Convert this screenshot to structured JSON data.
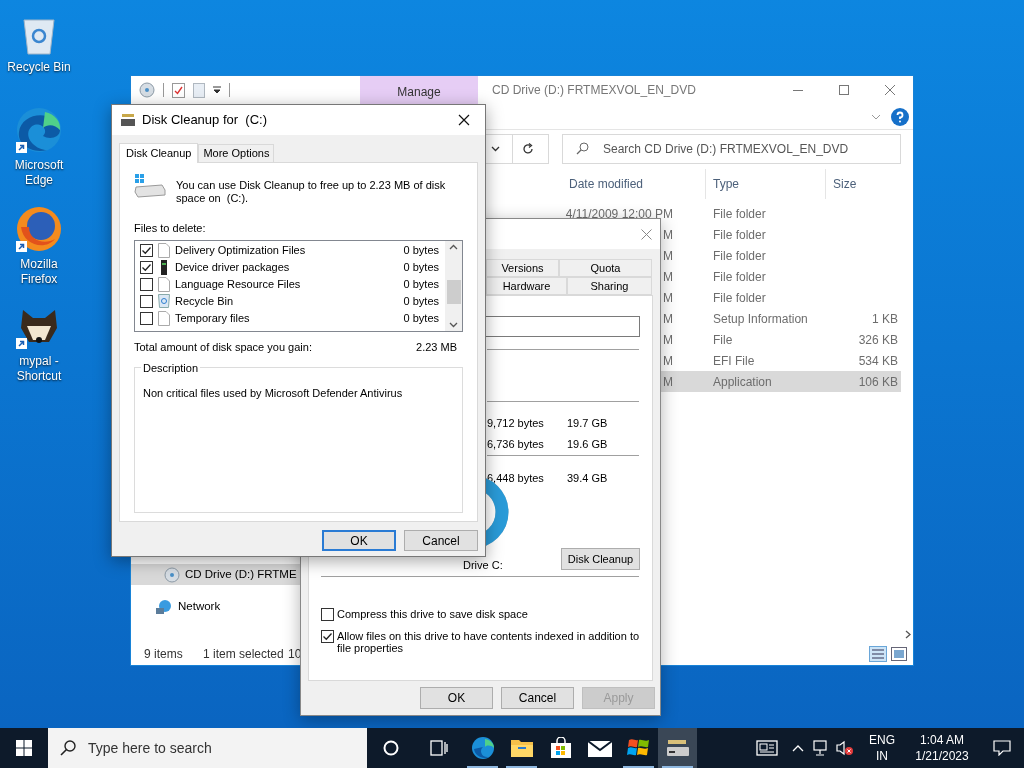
{
  "desktop_icons": [
    {
      "kind": "recycle",
      "label": "Recycle Bin"
    },
    {
      "kind": "edge",
      "label": "Microsoft Edge"
    },
    {
      "kind": "firefox",
      "label": "Mozilla Firefox"
    },
    {
      "kind": "raccoon",
      "label": "mypal - Shortcut"
    }
  ],
  "explorer": {
    "manage_tab": "Manage",
    "title": "CD Drive (D:) FRTMEXVOL_EN_DVD",
    "search": {
      "placeholder": "Search CD Drive (D:) FRTMEXVOL_EN_DVD"
    },
    "columns": [
      "Date modified",
      "Type",
      "Size"
    ],
    "rows": [
      {
        "date": "4/11/2009 12:00 PM",
        "type": "File folder",
        "selected": false
      },
      {
        "date": "M",
        "type": "File folder",
        "selected": false
      },
      {
        "date": "M",
        "type": "File folder",
        "selected": false
      },
      {
        "date": "M",
        "type": "File folder",
        "selected": false
      },
      {
        "date": "M",
        "type": "File folder",
        "selected": false
      },
      {
        "date": "M",
        "type": "Setup Information",
        "size": "1 KB",
        "selected": false
      },
      {
        "date": "M",
        "type": "File",
        "size": "326 KB",
        "selected": false
      },
      {
        "date": "M",
        "type": "EFI File",
        "size": "534 KB",
        "selected": false
      },
      {
        "date": "M",
        "type": "Application",
        "size": "106 KB",
        "selected": true
      }
    ],
    "nav": [
      {
        "kind": "cd",
        "label": "CD Drive (D:) FRTME",
        "selected": true
      },
      {
        "kind": "network",
        "label": "Network",
        "selected": false
      }
    ],
    "status_bar": [
      "9 items",
      "1 item selected",
      "10"
    ]
  },
  "properties": {
    "tabs": [
      {
        "label": "Versions"
      },
      {
        "label": "Quota"
      },
      {
        "label": "Hardware"
      },
      {
        "label": "Sharing"
      }
    ],
    "capacity": [
      {
        "bytes": "9,712 bytes",
        "size": "19.7 GB"
      },
      {
        "bytes": "6,736 bytes",
        "size": "19.6 GB"
      },
      {
        "bytes": "6,448 bytes",
        "size": "39.4 GB"
      }
    ],
    "drive_label": "Drive C:",
    "disk_cleanup_button": "Disk Cleanup",
    "options": [
      {
        "label": "Compress this drive to save disk space",
        "checked": false
      },
      {
        "label": "Allow files on this drive to have contents indexed in addition to file properties",
        "checked": true
      }
    ],
    "buttons": [
      {
        "label": "OK",
        "disabled": false
      },
      {
        "label": "Cancel",
        "disabled": false
      },
      {
        "label": "Apply",
        "disabled": true
      }
    ]
  },
  "disk_cleanup": {
    "title": "Disk Cleanup for  (C:)",
    "tabs": [
      {
        "label": "Disk Cleanup",
        "selected": true
      },
      {
        "label": "More Options",
        "selected": false
      }
    ],
    "intro": "You can use Disk Cleanup to free up to 2.23 MB of disk space on  (C:).",
    "files_label": "Files to delete:",
    "files": [
      {
        "kind": "file",
        "name": "Delivery Optimization Files",
        "size": "0 bytes",
        "checked": true
      },
      {
        "kind": "driver",
        "name": "Device driver packages",
        "size": "0 bytes",
        "checked": true
      },
      {
        "kind": "file",
        "name": "Language Resource Files",
        "size": "0 bytes",
        "checked": false
      },
      {
        "kind": "recycle",
        "name": "Recycle Bin",
        "size": "0 bytes",
        "checked": false
      },
      {
        "kind": "file",
        "name": "Temporary files",
        "size": "0 bytes",
        "checked": false
      }
    ],
    "total_label": "Total amount of disk space you gain:",
    "total_value": "2.23 MB",
    "description_label": "Description",
    "description": "Non critical files used by Microsoft Defender Antivirus",
    "buttons": [
      {
        "label": "OK",
        "default": true
      },
      {
        "label": "Cancel",
        "default": false
      }
    ]
  },
  "taskbar": {
    "search": {
      "placeholder": "Type here to search"
    },
    "apps": [
      {
        "kind": "edge",
        "running": true,
        "active": false
      },
      {
        "kind": "folder",
        "running": true,
        "active": false
      },
      {
        "kind": "store",
        "running": false,
        "active": false
      },
      {
        "kind": "mail",
        "running": false,
        "active": false
      },
      {
        "kind": "windows",
        "running": true,
        "active": false
      },
      {
        "kind": "cleanup",
        "running": true,
        "active": true
      }
    ],
    "language": [
      "ENG",
      "IN"
    ],
    "time": "1:04 AM",
    "date": "1/21/2023"
  }
}
